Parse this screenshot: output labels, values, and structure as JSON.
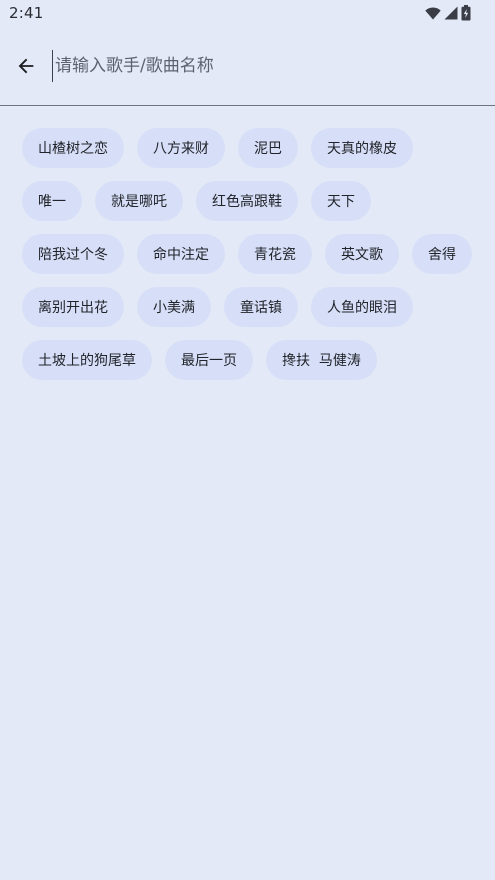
{
  "status": {
    "time": "2:41"
  },
  "search": {
    "placeholder": "请输入歌手/歌曲名称",
    "value": ""
  },
  "suggestions": [
    "山楂树之恋",
    "八方来财",
    "泥巴",
    "天真的橡皮",
    "唯一",
    "就是哪吒",
    "红色高跟鞋",
    "天下",
    "陪我过个冬",
    "命中注定",
    "青花瓷",
    "英文歌",
    "舍得",
    "离别开出花",
    "小美满",
    "童话镇",
    "人鱼的眼泪",
    "土坡上的狗尾草",
    "最后一页",
    "搀扶  马健涛"
  ],
  "icons": {
    "back": "arrow-back-icon",
    "wifi": "wifi-icon",
    "signal": "signal-icon",
    "battery": "battery-charging-icon"
  },
  "colors": {
    "background": "#e3e9f7",
    "chip": "#d6dff7",
    "divider": "#6f7480"
  }
}
